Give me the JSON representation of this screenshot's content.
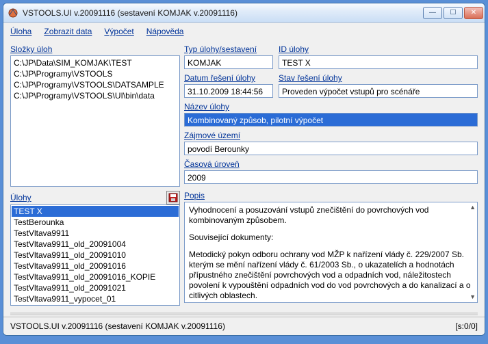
{
  "window": {
    "title": "VSTOOLS.UI v.20091116 (sestavení KOMJAK v.20091116)"
  },
  "menu": {
    "task": "Úloha",
    "showdata": "Zobrazit data",
    "calc": "Výpočet",
    "help": "Nápověda"
  },
  "labels": {
    "folders": "Složky úloh",
    "tasks": "Úlohy",
    "tasktype": "Typ úlohy/sestavení",
    "taskid": "ID úlohy",
    "date": "Datum řešení úlohy",
    "state": "Stav řešení úlohy",
    "name": "Název úlohy",
    "area": "Zájmové území",
    "timelevel": "Časová úroveň",
    "desc": "Popis"
  },
  "folders": [
    "C:\\JP\\Data\\SIM_KOMJAK\\TEST",
    "C:\\JP\\Programy\\VSTOOLS",
    "C:\\JP\\Programy\\VSTOOLS\\DATSAMPLE",
    "C:\\JP\\Programy\\VSTOOLS\\UI\\bin\\data"
  ],
  "tasks": [
    "TEST X",
    "TestBerounka",
    "TestVltava9911",
    "TestVltava9911_old_20091004",
    "TestVltava9911_old_20091010",
    "TestVltava9911_old_20091016",
    "TestVltava9911_old_20091016_KOPIE",
    "TestVltava9911_old_20091021",
    "TestVltava9911_vypocet_01"
  ],
  "fields": {
    "tasktype": "KOMJAK",
    "taskid": "TEST X",
    "date": "31.10.2009 18:44:56",
    "state": "Proveden výpočet vstupů pro scénáře",
    "name": "Kombinovaný způsob, pilotní výpočet",
    "area": "povodí Berounky",
    "timelevel": "2009"
  },
  "desc": {
    "p1": "Vyhodnocení a posuzování vstupů znečištění do povrchových vod kombinovaným způsobem.",
    "p2": "Související dokumenty:",
    "p3": "Metodický pokyn odboru ochrany vod MŽP k nařízení vlády č. 229/2007 Sb. kterým se mění nařízení vlády č. 61/2003 Sb., o ukazatelích a hodnotách přípustného znečištění povrchových vod a odpadních vod, náležitostech povolení k vypouštění odpadních vod do vod povrchových a do kanalizací a o citlivých oblastech."
  },
  "status": {
    "left": "VSTOOLS.UI v.20091116 (sestavení KOMJAK v.20091116)",
    "right": "[s:0/0]"
  }
}
